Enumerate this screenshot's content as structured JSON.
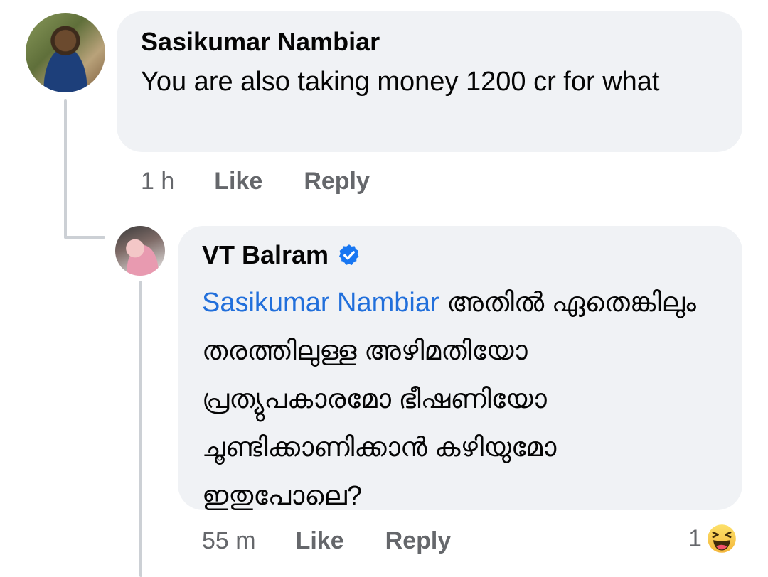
{
  "comments": [
    {
      "author": "Sasikumar Nambiar",
      "text": "You are also taking money 1200 cr for what",
      "time": "1 h",
      "like_label": "Like",
      "reply_label": "Reply"
    },
    {
      "author": "VT Balram",
      "verified": true,
      "mention": "Sasikumar Nambiar",
      "text": "അതിൽ ഏതെങ്കിലും തരത്തിലുള്ള അഴിമതിയോ പ്രത്യുപകാരമോ ഭീഷണിയോ ചൂണ്ടിക്കാണിക്കാൻ കഴിയുമോ ഇതുപോലെ?",
      "time": "55 m",
      "like_label": "Like",
      "reply_label": "Reply",
      "reaction_count": "1",
      "reaction_icon": "haha-emoji-icon"
    }
  ],
  "colors": {
    "bubble": "#f0f2f5",
    "mention": "#216fdb",
    "meta": "#65676b",
    "verified": "#1877f2"
  }
}
